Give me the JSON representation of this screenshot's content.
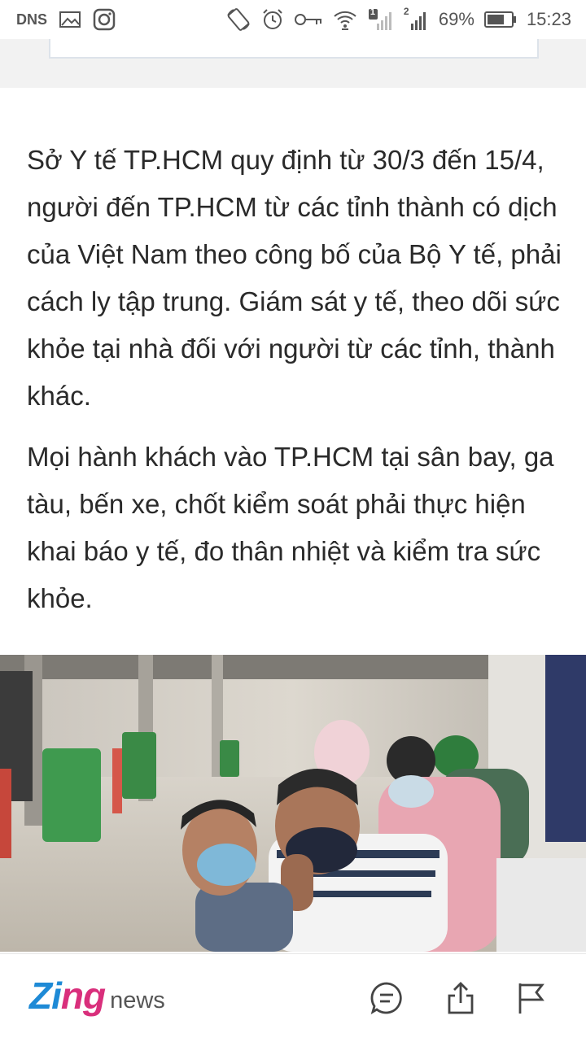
{
  "status_bar": {
    "carrier": "DNS",
    "sim1_label": "1",
    "sim2_label": "2",
    "battery": "69%",
    "time": "15:23",
    "icons": [
      "image-icon",
      "instagram-icon",
      "rotate-icon",
      "alarm-icon",
      "key-icon",
      "wifi-icon",
      "signal-icon",
      "signal-icon",
      "battery-icon"
    ]
  },
  "article": {
    "paragraphs": [
      "Sở Y tế TP.HCM quy định từ 30/3 đến 15/4, người đến TP.HCM từ các tỉnh thành có dịch của Việt Nam theo công bố của Bộ Y tế, phải cách ly tập trung. Giám sát y tế, theo dõi sức khỏe tại nhà đối với người từ các tỉnh, thành khác.",
      "Mọi hành khách vào TP.HCM tại sân bay, ga tàu, bến xe, chốt kiểm soát phải thực hiện khai báo y tế, đo thân nhiệt và kiểm tra sức khỏe."
    ]
  },
  "photo": {
    "subject": "people-wearing-masks-at-bus-station"
  },
  "bottom_bar": {
    "logo_zing": "Zing",
    "logo_news": "news",
    "actions": [
      "comment-icon",
      "share-icon",
      "flag-icon"
    ]
  },
  "colors": {
    "zing_blue": "#1e8ad6",
    "zing_pink": "#d92f7c",
    "text": "#2a2a2a",
    "band": "#f2f2f2"
  }
}
